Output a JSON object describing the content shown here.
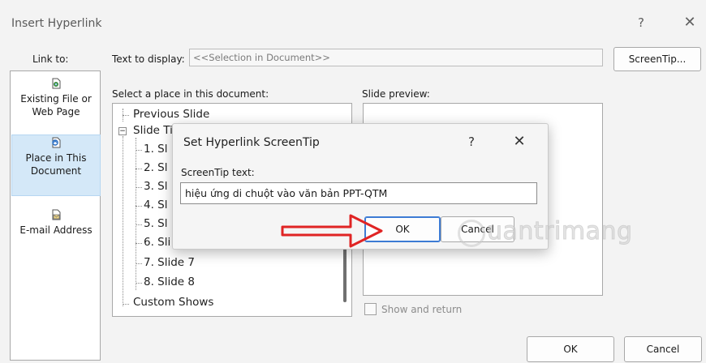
{
  "window": {
    "title": "Insert Hyperlink",
    "help_glyph": "?",
    "close_glyph": "✕"
  },
  "link_to": {
    "label": "Link to:",
    "items": [
      {
        "label": "Existing File or Web Page",
        "icon": "existing-file-icon"
      },
      {
        "label": "Place in This Document",
        "icon": "place-in-document-icon",
        "selected": true
      },
      {
        "label": "E-mail Address",
        "icon": "email-address-icon"
      }
    ]
  },
  "text_to_display": {
    "label": "Text to display:",
    "value": "<<Selection in Document>>"
  },
  "screentip_button": "ScreenTip...",
  "place": {
    "label": "Select a place in this document:",
    "items": [
      "Previous Slide",
      "Slide Titles",
      "1. Sl",
      "2. Sl",
      "3. Sl",
      "4. Sl",
      "5. Sl",
      "6. Sli",
      "7. Slide 7",
      "8. Slide 8",
      "Custom Shows"
    ]
  },
  "preview": {
    "label": "Slide preview:",
    "show_and_return": "Show and return"
  },
  "buttons": {
    "ok": "OK",
    "cancel": "Cancel"
  },
  "screentip_dialog": {
    "title": "Set Hyperlink ScreenTip",
    "help_glyph": "?",
    "close_glyph": "✕",
    "field_label": "ScreenTip text:",
    "field_value": "hiệu ứng di chuột vào văn bản PPT-QTM",
    "ok": "OK",
    "cancel": "Cancel"
  },
  "watermark": "uantrimang",
  "colors": {
    "selection": "#d4e8f8",
    "arrow": "#e02424",
    "default_button_border": "#3d7bd4"
  }
}
